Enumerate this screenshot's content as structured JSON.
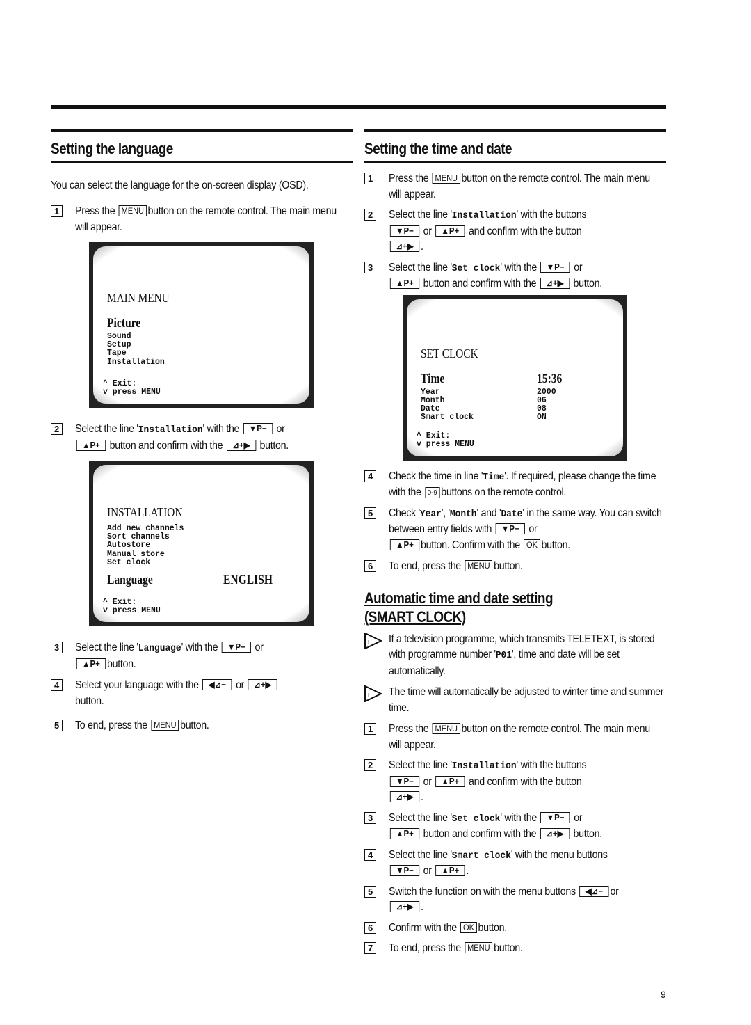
{
  "page_number": "9",
  "keys": {
    "menu": "MENU",
    "p_minus": "▼P−",
    "p_plus": "▲P+",
    "vol_plus": "⊿+▶",
    "vol_minus": "◀⊿−",
    "digits": "0-9",
    "ok": "OK"
  },
  "left": {
    "title": "Setting the language",
    "intro": "You can select the language for the on-screen display (OSD).",
    "steps": [
      {
        "num": "1",
        "a": "Press the",
        "b": "button on the remote control. The main menu will appear."
      },
      {
        "num": "2",
        "a": "Select the line '",
        "code": "Installation",
        "b": "' with the",
        "c": "or",
        "d": "button and confirm with the",
        "e": "button."
      },
      {
        "num": "3",
        "a": "Select the line '",
        "code": "Language",
        "b": "' with the",
        "c": "or",
        "d": "button."
      },
      {
        "num": "4",
        "a": "Select your language with the",
        "c": "or",
        "d": "button."
      },
      {
        "num": "5",
        "a": "To end, press the",
        "b": "button."
      }
    ],
    "screen_main": {
      "title": "MAIN MENU",
      "selected": "Picture",
      "items": [
        "Sound",
        "Setup",
        "Tape",
        "Installation"
      ],
      "exit_line1": "^ Exit:",
      "exit_line2": "v press MENU"
    },
    "screen_install": {
      "title": "INSTALLATION",
      "items": [
        "Add new channels",
        "Sort channels",
        "Autostore",
        "Manual store",
        "Set clock"
      ],
      "selected": "Language",
      "selected_value": "ENGLISH",
      "exit_line1": "^ Exit:",
      "exit_line2": "v press MENU"
    }
  },
  "right": {
    "title": "Setting the time and date",
    "steps": [
      {
        "num": "1",
        "a": "Press the",
        "b": "button on the remote control. The main menu will appear."
      },
      {
        "num": "2",
        "a": "Select the line '",
        "code": "Installation",
        "b": "' with the buttons",
        "c": "or",
        "d": "and confirm with the button",
        "e": "."
      },
      {
        "num": "3",
        "a": "Select the line '",
        "code": "Set clock",
        "b": "' with the",
        "c": "or",
        "d": "button and confirm with the",
        "e": "button."
      },
      {
        "num": "4",
        "a": "Check the time in line '",
        "code": "Time",
        "b": "'. If required, please change the time with the",
        "c": "buttons on the remote control."
      },
      {
        "num": "5",
        "a": "Check '",
        "code1": "Year",
        "s1": "', '",
        "code2": "Month",
        "s2": "' and '",
        "code3": "Date",
        "b": "' in the same way. You can switch between entry fields with",
        "c": "or",
        "d": "button. Confirm with the",
        "e": "button."
      },
      {
        "num": "6",
        "a": "To end, press the",
        "b": "button."
      }
    ],
    "screen_clock": {
      "title": "SET CLOCK",
      "selected": "Time",
      "selected_value": "15:36",
      "items": [
        "Year",
        "Month",
        "Date",
        "Smart clock"
      ],
      "values": [
        "2000",
        "06",
        "08",
        "ON"
      ],
      "exit_line1": "^ Exit:",
      "exit_line2": "v press MENU"
    },
    "smart": {
      "title_line1": "Automatic time and date setting",
      "title_line2": "(SMART CLOCK)",
      "notes": [
        {
          "a": "If a television programme, which transmits TELETEXT, is stored with programme number '",
          "code": "P01",
          "b": "', time and date will be set automatically."
        },
        {
          "a": "The time will automatically be adjusted to winter time and summer time."
        }
      ],
      "steps": [
        {
          "num": "1",
          "a": "Press the",
          "b": "button on the remote control. The main menu will appear."
        },
        {
          "num": "2",
          "a": "Select the line '",
          "code": "Installation",
          "b": "' with the buttons",
          "c": "or",
          "d": "and confirm with the button",
          "e": "."
        },
        {
          "num": "3",
          "a": "Select the line '",
          "code": "Set clock",
          "b": "' with the",
          "c": "or",
          "d": "button and confirm with the",
          "e": "button."
        },
        {
          "num": "4",
          "a": "Select the line '",
          "code": "Smart clock",
          "b": "' with the menu buttons",
          "c": "or",
          "e": "."
        },
        {
          "num": "5",
          "a": "Switch the function on with the menu buttons",
          "c": "or",
          "e": "."
        },
        {
          "num": "6",
          "a": "Confirm with the",
          "b": "button."
        },
        {
          "num": "7",
          "a": "To end, press the",
          "b": "button."
        }
      ]
    }
  }
}
